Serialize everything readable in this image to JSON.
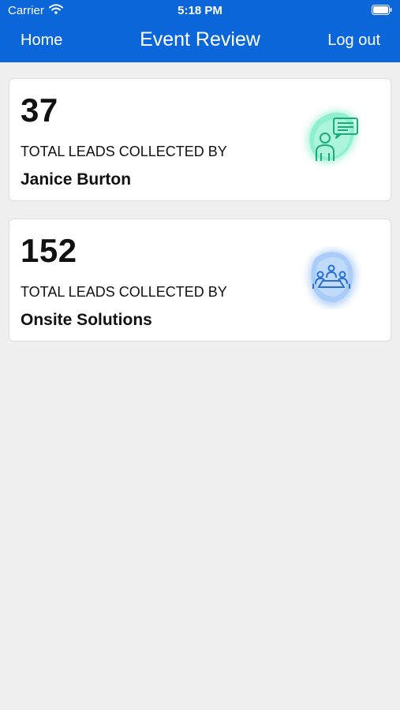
{
  "status_bar": {
    "carrier": "Carrier",
    "time": "5:18 PM",
    "wifi_icon": "wifi-icon",
    "battery_icon": "battery-icon"
  },
  "header": {
    "home_label": "Home",
    "title": "Event Review",
    "logout_label": "Log out",
    "color": "#0a66d9"
  },
  "cards": [
    {
      "count": "37",
      "label": "TOTAL LEADS COLLECTED BY",
      "name": "Janice Burton",
      "icon": "person-chat-icon",
      "accent": "#2ecf95"
    },
    {
      "count": "152",
      "label": "TOTAL LEADS COLLECTED BY",
      "name": "Onsite Solutions",
      "icon": "team-meeting-icon",
      "accent": "#2f7fe0"
    }
  ]
}
